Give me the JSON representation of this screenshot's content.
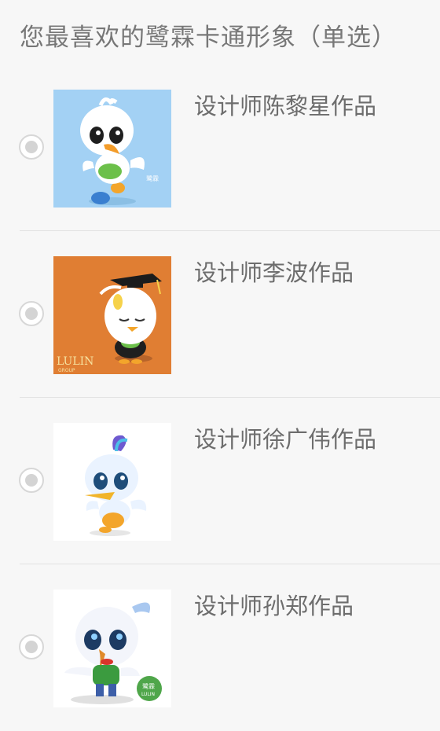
{
  "question": {
    "title": "您最喜欢的鹭霖卡通形象（单选）",
    "type": "single-choice"
  },
  "options": [
    {
      "label": "设计师陈黎星作品",
      "selected": false,
      "image": "cartoon-egret-blue-background"
    },
    {
      "label": "设计师李波作品",
      "selected": false,
      "image": "cartoon-egret-graduate-orange-background",
      "image_text": [
        "LULIN",
        "GROUP"
      ]
    },
    {
      "label": "设计师徐广伟作品",
      "selected": false,
      "image": "cartoon-egret-crest-white-background"
    },
    {
      "label": "设计师孙郑作品",
      "selected": false,
      "image": "cartoon-egret-3d-white-background",
      "image_text": [
        "鹭霖",
        "LULIN"
      ]
    }
  ],
  "colors": {
    "background": "#f7f7f7",
    "text": "#6d6d6d",
    "radio_border": "#d7d7d7",
    "radio_dot": "#d4d4d4",
    "thumb1_bg": "#9fd0f5",
    "thumb2_bg": "#e07e33"
  }
}
